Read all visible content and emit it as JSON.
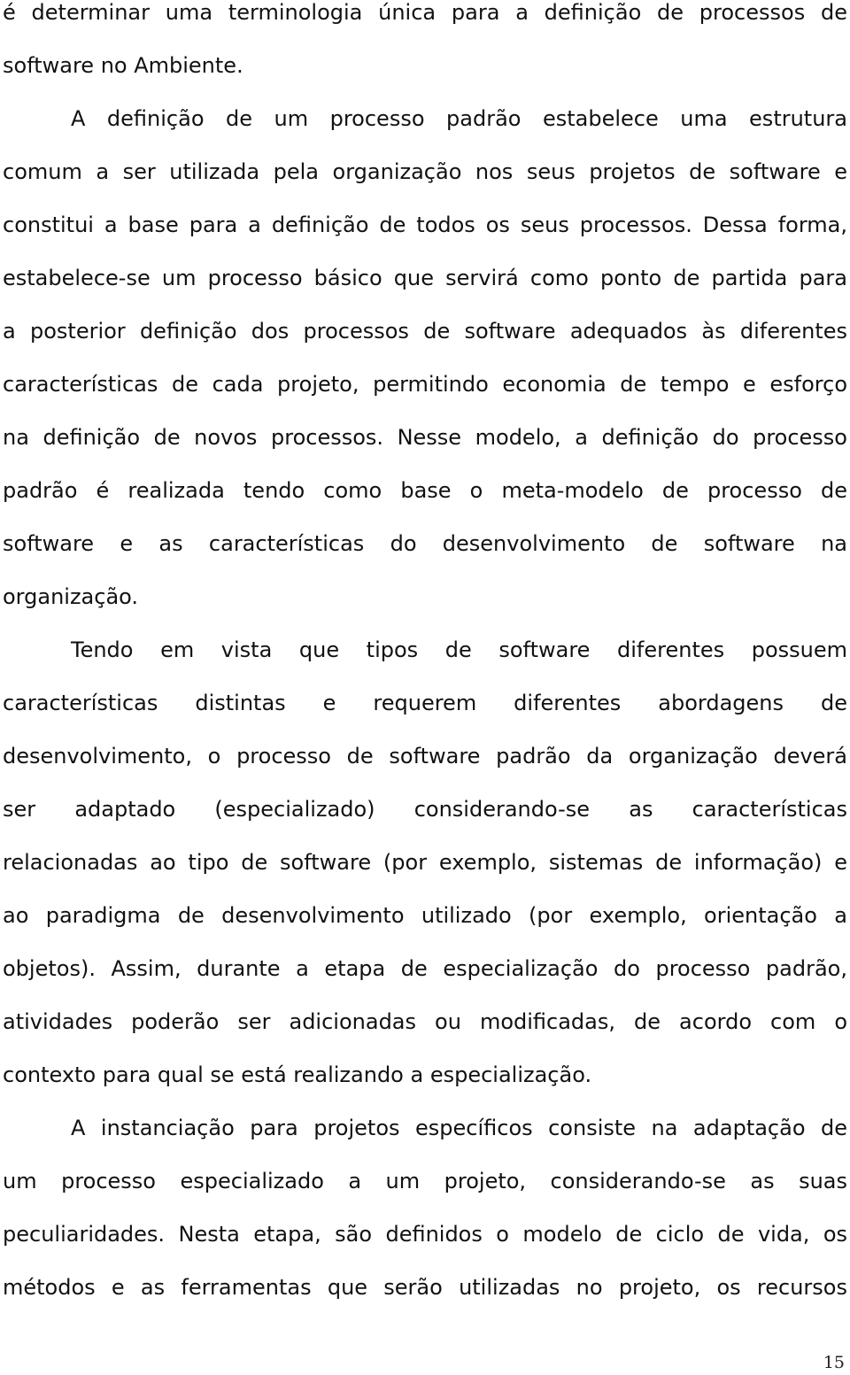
{
  "document": {
    "paragraphs": [
      {
        "indent": false,
        "lines": [
          "é determinar uma terminologia única para a definição de processos de",
          "software no Ambiente."
        ]
      },
      {
        "indent": true,
        "lines": [
          "A definição de um processo padrão estabelece uma estrutura",
          "comum a ser utilizada pela organização nos seus projetos de software e",
          "constitui a base para a definição de todos os seus processos. Dessa forma,",
          "estabelece-se um processo básico que servirá como ponto de partida para",
          "a posterior definição dos processos de software adequados às diferentes",
          "características de cada projeto, permitindo economia de tempo e esforço",
          "na definição de novos processos. Nesse modelo, a definição do processo",
          "padrão é realizada tendo como base o meta-modelo de processo de",
          "software e as características do desenvolvimento de software na",
          "organização."
        ]
      },
      {
        "indent": true,
        "lines": [
          "Tendo em vista que tipos de software diferentes possuem",
          "características distintas e requerem diferentes abordagens de",
          "desenvolvimento, o processo de software padrão da organização deverá",
          "ser adaptado (especializado) considerando-se as características",
          "relacionadas ao tipo de software (por exemplo, sistemas de informação) e",
          "ao paradigma de desenvolvimento utilizado (por exemplo, orientação a",
          "objetos). Assim, durante a etapa de especialização do processo padrão,",
          "atividades poderão ser adicionadas ou modificadas, de acordo com o",
          "contexto para qual se está realizando a especialização."
        ]
      },
      {
        "indent": true,
        "lines": [
          "A instanciação para projetos específicos consiste na adaptação de",
          "um processo especializado a um projeto, considerando-se as suas",
          "peculiaridades. Nesta etapa, são definidos o modelo de ciclo de vida, os",
          "métodos e as ferramentas que serão utilizadas no projeto, os recursos"
        ]
      }
    ],
    "page_number": "15"
  }
}
